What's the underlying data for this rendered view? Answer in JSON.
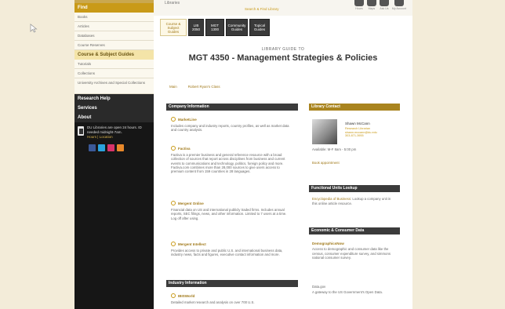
{
  "topbar": {
    "site_text": "Libraries",
    "link": "Search & Find Library",
    "icons": [
      {
        "name": "hours-icon",
        "label": "Hours"
      },
      {
        "name": "maps-icon",
        "label": "Maps"
      },
      {
        "name": "ask-icon",
        "label": "Ask Us"
      },
      {
        "name": "account-icon",
        "label": "My Account"
      }
    ]
  },
  "sidebar": {
    "find_header": "Find",
    "find_items": [
      "Books",
      "Articles",
      "Databases",
      "Course Reserves"
    ],
    "guides_header": "Course & Subject Guides",
    "guides_items": [
      "Tutorials",
      "Collections",
      "University Archives and Special Collections"
    ],
    "sections": [
      "Research Help",
      "Services",
      "About"
    ],
    "hours_text": "DU Libraries are open 24 hours. ID needed midnight-7am.",
    "hours_link": "Hours | Location",
    "social": [
      {
        "name": "facebook-icon",
        "color": "#3b5998"
      },
      {
        "name": "twitter-icon",
        "color": "#2aa3dd"
      },
      {
        "name": "flickr-icon",
        "color": "#d8336a"
      },
      {
        "name": "rss-icon",
        "color": "#e8882a"
      }
    ]
  },
  "tabs": [
    {
      "label": "Course & Subject Guides",
      "active": true
    },
    {
      "label": "LIB 2050",
      "active": false
    },
    {
      "label": "MGT 1300",
      "active": false
    },
    {
      "label": "Community Guides",
      "active": false
    },
    {
      "label": "Topical Guides",
      "active": false
    }
  ],
  "guide": {
    "subtitle": "LIBRARY GUIDE TO",
    "title": "MGT 4350 - Management Strategies & Policies",
    "crumb_main": "Main",
    "crumb_page": "Robert Ryan's Class"
  },
  "company_box": {
    "header": "Company Information",
    "entries": [
      {
        "title": "MarketLine",
        "desc": "Includes company and industry reports, country profiles, as well as market data and country analysis."
      },
      {
        "title": "Factiva",
        "desc": "Factiva is a premier business and general reference resource with a broad collection of sources that report across disciplines from business and current events to communications and technology, politics, foreign policy and more. Factiva.com combines more than 28,000 sources to give users access to premium content from 159 countries in 28 languages."
      },
      {
        "title": "Mergent Online",
        "desc": "Financial data on US and international publicly traded firms. Includes annual reports, SEC filings, news, and other information. Limited to 7 users at a time. Log off after using."
      },
      {
        "title": "Mergent Intellect",
        "desc": "Provides access to private and public U.S. and international business data, industry news, facts and figures, executive contact information and more."
      }
    ]
  },
  "industry_box": {
    "header": "Industry Information",
    "entries": [
      {
        "title": "IBISWorld",
        "desc": "Detailed market research and analysis on over 700 U.S."
      }
    ]
  },
  "contact_box": {
    "header": "Library Contact",
    "name": "Shawn McCann",
    "details": [
      "Research Librarian",
      "shawn.mccann@du.edu",
      "303-871-3955"
    ],
    "availability": "Available: M-F 8am - 5:00 pm",
    "link": "Book appointment"
  },
  "functional_box": {
    "header": "Functional Units Lookup",
    "link": "Encyclopedia of Business",
    "text": ": Lookup a company unit in this online article resource."
  },
  "economic_box": {
    "header": "Economic & Consumer Data",
    "entry1_title": "DemographicsNow",
    "entry1_desc": "Access to demographic and consumer data like the census, consumer expenditure survey, and simmons national consumer survey.",
    "entry2_title": "Data.gov",
    "entry2_desc": "A gateway to the US Government's Open Data."
  }
}
